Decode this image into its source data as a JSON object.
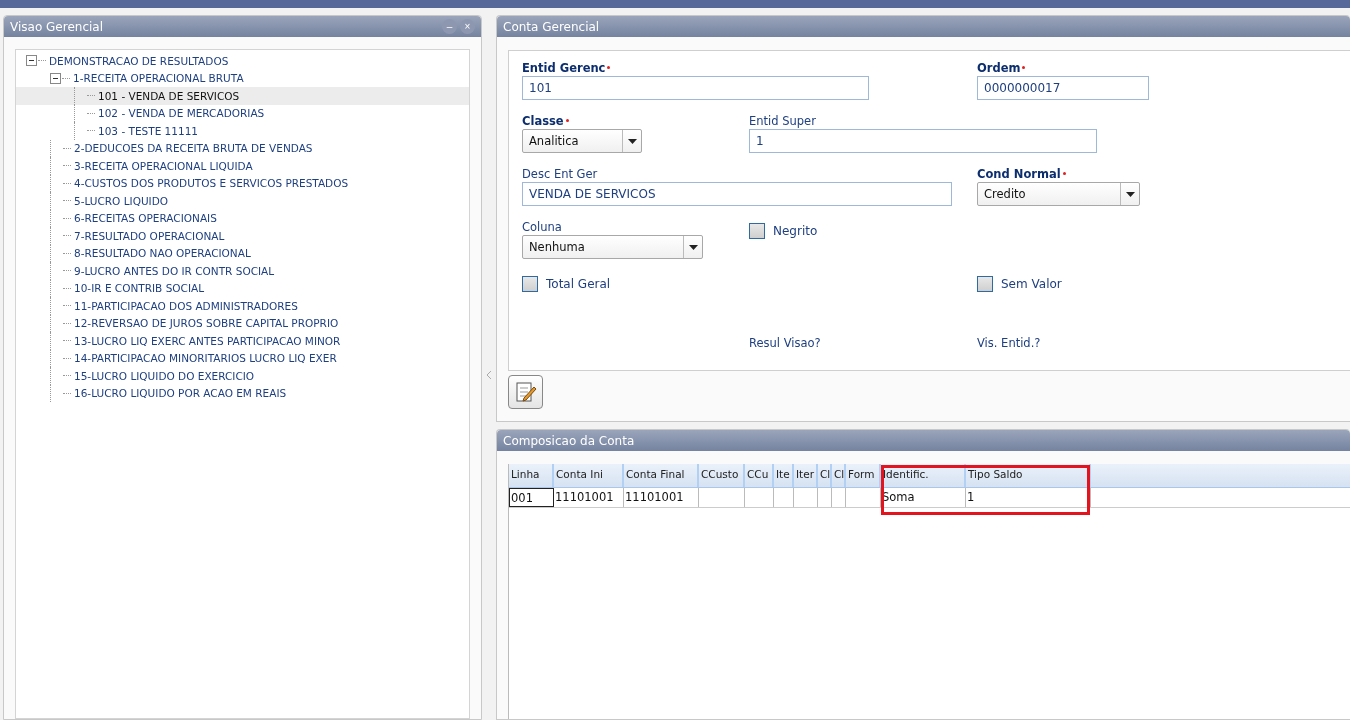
{
  "left_panel": {
    "title": "Visao Gerencial",
    "buttons": [
      "–",
      "×"
    ],
    "tree": [
      {
        "label": "DEMONSTRACAO DE RESULTADOS",
        "expanded": true,
        "selected": false,
        "children": [
          {
            "label": "1-RECEITA OPERACIONAL BRUTA",
            "expanded": true,
            "selected": false,
            "children": [
              {
                "label": "101 - VENDA DE SERVICOS",
                "selected": true
              },
              {
                "label": "102 - VENDA DE MERCADORIAS",
                "selected": false
              },
              {
                "label": "103 - TESTE 11111",
                "selected": false
              }
            ]
          },
          {
            "label": "2-DEDUCOES DA RECEITA BRUTA DE VENDAS",
            "selected": false
          },
          {
            "label": "3-RECEITA OPERACIONAL LIQUIDA",
            "selected": false
          },
          {
            "label": "4-CUSTOS DOS PRODUTOS E SERVICOS PRESTADOS",
            "selected": false
          },
          {
            "label": "5-LUCRO LIQUIDO",
            "selected": false
          },
          {
            "label": "6-RECEITAS OPERACIONAIS",
            "selected": false
          },
          {
            "label": "7-RESULTADO OPERACIONAL",
            "selected": false
          },
          {
            "label": "8-RESULTADO NAO OPERACIONAL",
            "selected": false
          },
          {
            "label": "9-LUCRO ANTES DO IR CONTR SOCIAL",
            "selected": false
          },
          {
            "label": "10-IR E CONTRIB SOCIAL",
            "selected": false
          },
          {
            "label": "11-PARTICIPACAO DOS ADMINISTRADORES",
            "selected": false
          },
          {
            "label": "12-REVERSAO DE JUROS SOBRE CAPITAL PROPRIO",
            "selected": false
          },
          {
            "label": "13-LUCRO LIQ EXERC ANTES PARTICIPACAO MINOR",
            "selected": false
          },
          {
            "label": "14-PARTICIPACAO MINORITARIOS LUCRO LIQ EXER",
            "selected": false
          },
          {
            "label": "15-LUCRO LIQUIDO DO EXERCICIO",
            "selected": false
          },
          {
            "label": "16-LUCRO LIQUIDO POR ACAO EM REAIS",
            "selected": false
          }
        ]
      }
    ]
  },
  "account_panel": {
    "title": "Conta Gerencial",
    "fields": [
      {
        "kind": "text",
        "label": "Entid Gerenc",
        "required": true,
        "value": "101"
      },
      {
        "kind": "text",
        "label": "Ordem",
        "required": true,
        "value": "0000000017"
      },
      {
        "kind": "select",
        "label": "Classe",
        "required": true,
        "value": "Analitica"
      },
      {
        "kind": "text",
        "label": "Entid Super",
        "required": false,
        "value": "1"
      },
      {
        "kind": "text",
        "label": "Desc Ent Ger",
        "required": false,
        "value": "VENDA DE SERVICOS"
      },
      {
        "kind": "select",
        "label": "Cond Normal",
        "required": true,
        "value": "Credito"
      },
      {
        "kind": "select",
        "label": "Coluna",
        "required": false,
        "value": "Nenhuma"
      },
      {
        "kind": "checkbox",
        "label": "Negrito",
        "checked": false
      },
      {
        "kind": "checkbox",
        "label": "Total Geral",
        "checked": false
      },
      {
        "kind": "checkbox",
        "label": "Sem Valor",
        "checked": false
      },
      {
        "kind": "caption",
        "label": "Resul Visao?"
      },
      {
        "kind": "caption",
        "label": "Vis. Entid.?"
      }
    ]
  },
  "composition_panel": {
    "title": "Composicao da Conta",
    "columns": [
      "Linha",
      "Conta Ini",
      "Conta Final",
      "CCusto",
      "CCu",
      "Ite",
      "Iter",
      "Cl",
      "Cl",
      "Form",
      "Identific.",
      "Tipo Saldo"
    ],
    "rows": [
      [
        "001",
        "11101001",
        "11101001",
        "",
        "",
        "",
        "",
        "",
        "",
        "",
        "Soma",
        "1"
      ]
    ]
  }
}
